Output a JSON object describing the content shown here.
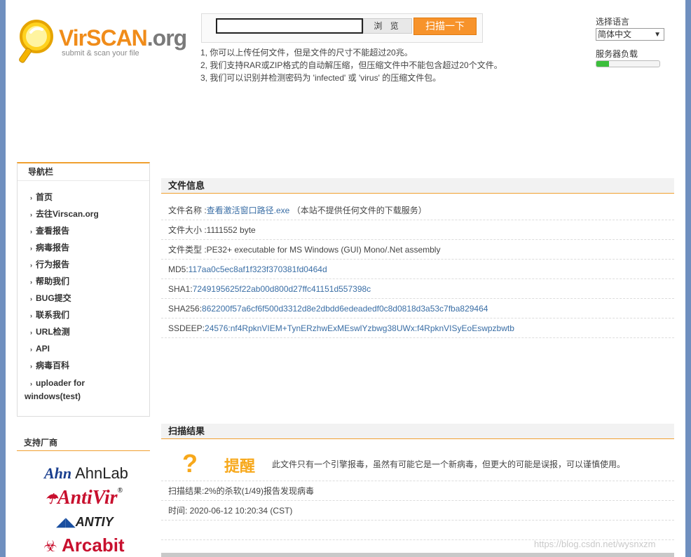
{
  "logo": {
    "name_a": "VirSCAN",
    "name_b": ".org",
    "tagline": "submit & scan your file"
  },
  "upload": {
    "browse_label": "浏 览",
    "scan_label": "扫描一下"
  },
  "notes": [
    "1, 你可以上传任何文件，但是文件的尺寸不能超过20兆。",
    "2, 我们支持RAR或ZIP格式的自动解压缩，但压缩文件中不能包含超过20个文件。",
    "3, 我们可以识别并检测密码为 'infected' 或 'virus' 的压缩文件包。"
  ],
  "language": {
    "label": "选择语言",
    "selected": "简体中文"
  },
  "server_load": {
    "label": "服务器负载",
    "fraction": 0.2
  },
  "nav": {
    "title": "导航栏",
    "items": [
      "首页",
      "去往Virscan.org",
      "查看报告",
      "病毒报告",
      "行为报告",
      "帮助我们",
      "BUG提交",
      "联系我们",
      "URL检测",
      "API",
      "病毒百科",
      "uploader for",
      "windows(test)"
    ]
  },
  "vendors": {
    "title": "支持厂商",
    "names": [
      "AhnLab",
      "AntiVir",
      "ANTIY",
      "Arcabit"
    ]
  },
  "file_info": {
    "title": "文件信息",
    "name_label": "文件名称 :",
    "name_value": "查看激活窗口路径.exe",
    "name_note": "（本站不提供任何文件的下载服务）",
    "size_label": "文件大小 :",
    "size_value": "1111552 byte",
    "type_label": "文件类型 :",
    "type_value": "PE32+ executable for MS Windows (GUI) Mono/.Net assembly",
    "md5_label": "MD5:",
    "md5_value": "117aa0c5ec8af1f323f370381fd0464d",
    "sha1_label": "SHA1:",
    "sha1_value": "7249195625f22ab00d800d27ffc41151d557398c",
    "sha256_label": "SHA256:",
    "sha256_value": "862200f57a6cf6f500d3312d8e2dbdd6edeadedf0c8d0818d3a53c7fba829464",
    "ssdeep_label": "SSDEEP:",
    "ssdeep_value": "24576:nf4RpknVIEM+TynERzhwExMEswlYzbwg38UWx:f4RpknVISyEoEswpzbwtb"
  },
  "scan_result": {
    "title": "扫描结果",
    "alert_title": "提醒",
    "alert_text": "此文件只有一个引擎报毒，虽然有可能它是一个新病毒，但更大的可能是误报，可以谨慎使用。",
    "summary": "扫描结果:2%的杀软(1/49)报告发现病毒",
    "time": "时间: 2020-06-12 10:20:34 (CST)"
  },
  "watermark": "https://blog.csdn.net/wysnxzm"
}
